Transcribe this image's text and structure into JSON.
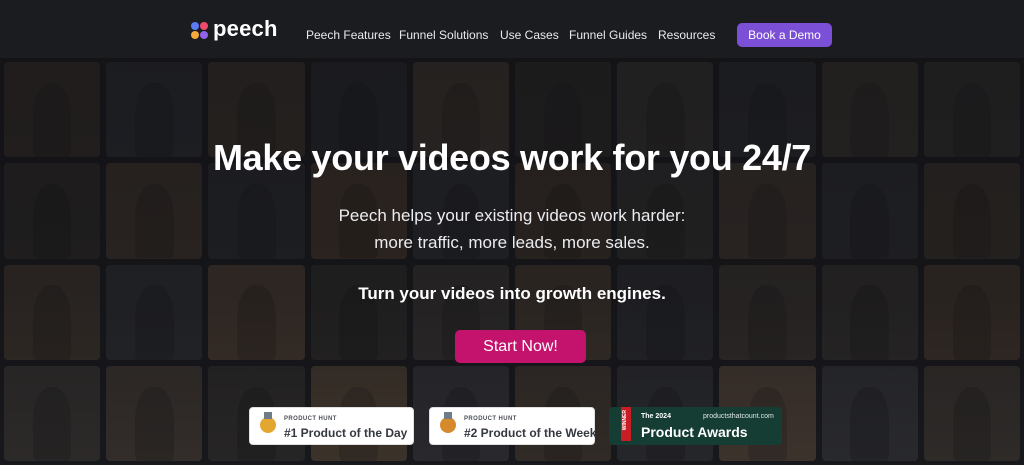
{
  "nav": {
    "logo_text": "peech",
    "links": [
      "Peech Features",
      "Funnel Solutions",
      "Use Cases",
      "Funnel Guides",
      "Resources"
    ],
    "cta": "Book a Demo"
  },
  "hero": {
    "headline": "Make your videos work for you 24/7",
    "sub_line1": "Peech helps your existing videos work harder:",
    "sub_line2": "more traffic, more leads, more sales.",
    "tagline": "Turn your videos into growth engines.",
    "cta": "Start Now!"
  },
  "badges": [
    {
      "label_small": "PRODUCT HUNT",
      "label_big": "#1 Product of the Day"
    },
    {
      "label_small": "PRODUCT HUNT",
      "label_big": "#2 Product of the Week"
    }
  ],
  "award": {
    "ribbon": "WINNER",
    "year": "The 2024",
    "site": "productsthatcount.com",
    "title": "Product Awards"
  },
  "colors": {
    "nav_bg": "#1b1c20",
    "brand_purple": "#7b4fd6",
    "cta_magenta": "#c4136d",
    "award_green": "#153d33",
    "gold_medal": "#e3a72f",
    "bronze_medal": "#d68a2c"
  },
  "icons": {
    "logo": "peech-logo-icon",
    "badge1": "gold-medal-icon",
    "badge2": "bronze-medal-icon"
  }
}
